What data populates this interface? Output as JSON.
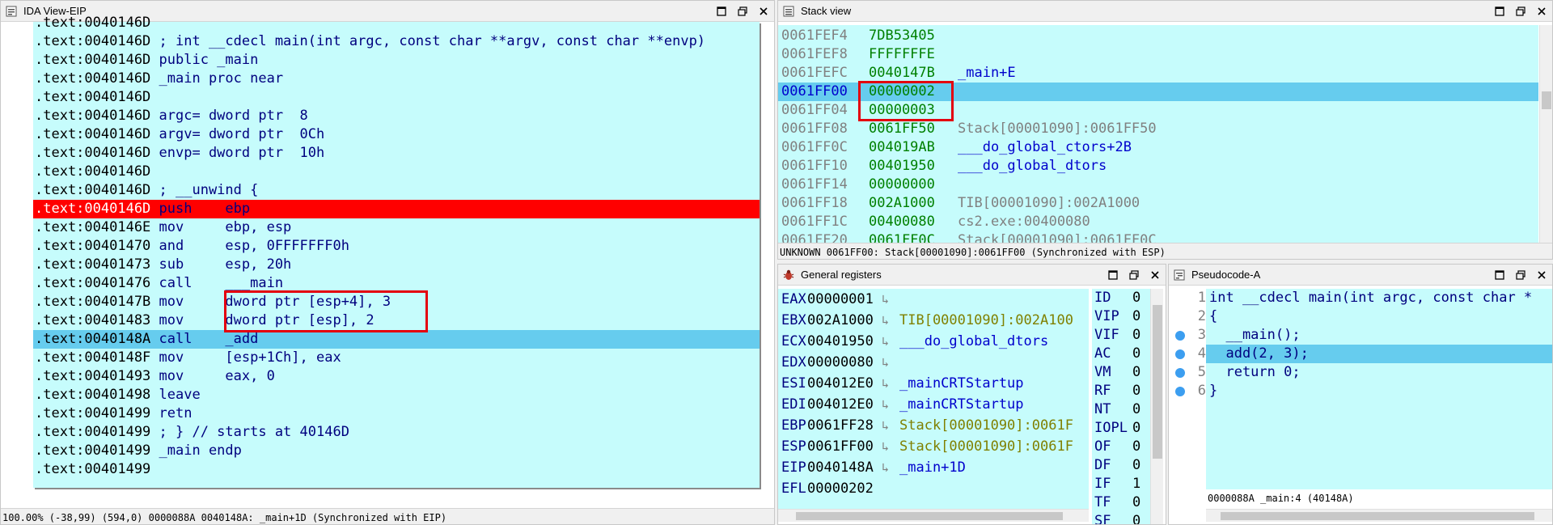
{
  "ida_view": {
    "title": "IDA View-EIP",
    "lines": [
      {
        "addr": ".text:0040146D",
        "text": ""
      },
      {
        "addr": ".text:0040146D",
        "text": " ; int __cdecl main(int argc, const char **argv, const char **envp)"
      },
      {
        "addr": ".text:0040146D",
        "text": " public _main"
      },
      {
        "addr": ".text:0040146D",
        "text": " _main proc near"
      },
      {
        "addr": ".text:0040146D",
        "text": ""
      },
      {
        "addr": ".text:0040146D",
        "text": " argc= dword ptr  8"
      },
      {
        "addr": ".text:0040146D",
        "text": " argv= dword ptr  0Ch"
      },
      {
        "addr": ".text:0040146D",
        "text": " envp= dword ptr  10h"
      },
      {
        "addr": ".text:0040146D",
        "text": ""
      },
      {
        "addr": ".text:0040146D",
        "text": " ; __unwind {"
      },
      {
        "addr": ".text:0040146D",
        "text": " push    ebp"
      },
      {
        "addr": ".text:0040146E",
        "text": " mov     ebp, esp"
      },
      {
        "addr": ".text:00401470",
        "text": " and     esp, 0FFFFFFF0h"
      },
      {
        "addr": ".text:00401473",
        "text": " sub     esp, 20h"
      },
      {
        "addr": ".text:00401476",
        "text": " call    ___main"
      },
      {
        "addr": ".text:0040147B",
        "text": " mov     dword ptr [esp+4], 3"
      },
      {
        "addr": ".text:00401483",
        "text": " mov     dword ptr [esp], 2"
      },
      {
        "addr": ".text:0040148A",
        "text": " call    _add"
      },
      {
        "addr": ".text:0040148F",
        "text": " mov     [esp+1Ch], eax"
      },
      {
        "addr": ".text:00401493",
        "text": " mov     eax, 0"
      },
      {
        "addr": ".text:00401498",
        "text": " leave"
      },
      {
        "addr": ".text:00401499",
        "text": " retn"
      },
      {
        "addr": ".text:00401499",
        "text": " ; } // starts at 40146D"
      },
      {
        "addr": ".text:00401499",
        "text": " _main endp"
      },
      {
        "addr": ".text:00401499",
        "text": ""
      }
    ],
    "current_line": 10,
    "selected_line": 17,
    "status": "100.00% (-38,99) (594,0) 0000088A 0040148A: _main+1D (Synchronized with EIP)"
  },
  "stack_view": {
    "title": "Stack view",
    "rows": [
      {
        "addr": "0061FEF4",
        "value": "7DB53405",
        "desc": ""
      },
      {
        "addr": "0061FEF8",
        "value": "FFFFFFFE",
        "desc": ""
      },
      {
        "addr": "0061FEFC",
        "value": "0040147B",
        "desc": "_main+E"
      },
      {
        "addr": "0061FF00",
        "value": "00000002",
        "desc": ""
      },
      {
        "addr": "0061FF04",
        "value": "00000003",
        "desc": ""
      },
      {
        "addr": "0061FF08",
        "value": "0061FF50",
        "desc": "Stack[00001090]:0061FF50"
      },
      {
        "addr": "0061FF0C",
        "value": "004019AB",
        "desc": "___do_global_ctors+2B"
      },
      {
        "addr": "0061FF10",
        "value": "00401950",
        "desc": "___do_global_dtors"
      },
      {
        "addr": "0061FF14",
        "value": "00000000",
        "desc": ""
      },
      {
        "addr": "0061FF18",
        "value": "002A1000",
        "desc": "TIB[00001090]:002A1000"
      },
      {
        "addr": "0061FF1C",
        "value": "00400080",
        "desc": "cs2.exe:00400080"
      },
      {
        "addr": "0061FF20",
        "value": "0061FF0C",
        "desc": "Stack[00001090]:0061FF0C"
      }
    ],
    "highlight_row": 3,
    "status": "UNKNOWN 0061FF00: Stack[00001090]:0061FF00 (Synchronized with ESP)"
  },
  "registers": {
    "title": "General registers",
    "rows": [
      {
        "name": "EAX",
        "value": "00000001",
        "arrow": "↳",
        "desc": ""
      },
      {
        "name": "EBX",
        "value": "002A1000",
        "arrow": "↳",
        "desc": "TIB[00001090]:002A100"
      },
      {
        "name": "ECX",
        "value": "00401950",
        "arrow": "↳",
        "desc": "___do_global_dtors"
      },
      {
        "name": "EDX",
        "value": "00000080",
        "arrow": "↳",
        "desc": ""
      },
      {
        "name": "ESI",
        "value": "004012E0",
        "arrow": "↳",
        "desc": "_mainCRTStartup"
      },
      {
        "name": "EDI",
        "value": "004012E0",
        "arrow": "↳",
        "desc": "_mainCRTStartup"
      },
      {
        "name": "EBP",
        "value": "0061FF28",
        "arrow": "↳",
        "desc": "Stack[00001090]:0061F"
      },
      {
        "name": "ESP",
        "value": "0061FF00",
        "arrow": "↳",
        "desc": "Stack[00001090]:0061F"
      },
      {
        "name": "EIP",
        "value": "0040148A",
        "arrow": "↳",
        "desc": "_main+1D"
      },
      {
        "name": "EFL",
        "value": "00000202",
        "arrow": "",
        "desc": ""
      }
    ],
    "flags": [
      {
        "name": "ID",
        "value": "0"
      },
      {
        "name": "VIP",
        "value": "0"
      },
      {
        "name": "VIF",
        "value": "0"
      },
      {
        "name": "AC",
        "value": "0"
      },
      {
        "name": "VM",
        "value": "0"
      },
      {
        "name": "RF",
        "value": "0"
      },
      {
        "name": "NT",
        "value": "0"
      },
      {
        "name": "IOPL",
        "value": "0"
      },
      {
        "name": "OF",
        "value": "0"
      },
      {
        "name": "DF",
        "value": "0"
      },
      {
        "name": "IF",
        "value": "1"
      },
      {
        "name": "TF",
        "value": "0"
      },
      {
        "name": "SF",
        "value": "0"
      }
    ]
  },
  "pseudocode": {
    "title": "Pseudocode-A",
    "lines": [
      {
        "num": "1",
        "text": "int __cdecl main(int argc, const char *",
        "dot": false
      },
      {
        "num": "2",
        "text": "{",
        "dot": false
      },
      {
        "num": "3",
        "text": "  __main();",
        "dot": true
      },
      {
        "num": "4",
        "text": "  add(2, 3);",
        "dot": true
      },
      {
        "num": "5",
        "text": "  return 0;",
        "dot": true
      },
      {
        "num": "6",
        "text": "}",
        "dot": true
      }
    ],
    "highlight_line": 3,
    "status": "0000088A _main:4 (40148A)"
  },
  "colors": {
    "listing_bg": "#c6fcfc",
    "current_line": "#ff0000",
    "selected_line": "#66ccee",
    "annotation_box": "#e3000f"
  }
}
